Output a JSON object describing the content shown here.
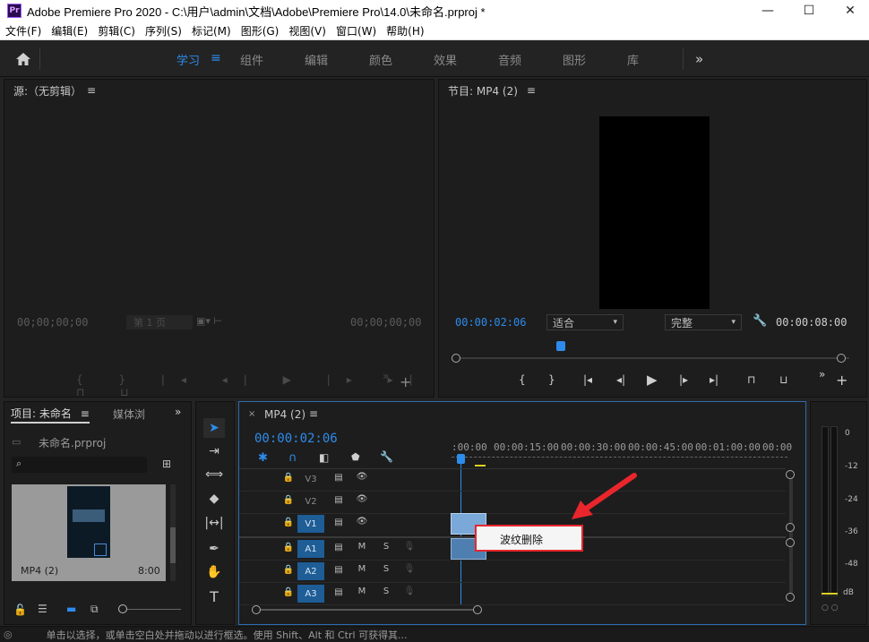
{
  "window": {
    "logo_text": "Pr",
    "title": "Adobe Premiere Pro 2020 - C:\\用户\\admin\\文档\\Adobe\\Premiere Pro\\14.0\\未命名.prproj *",
    "minimize": "—",
    "maximize": "☐",
    "close": "✕"
  },
  "menu": [
    "文件(F)",
    "编辑(E)",
    "剪辑(C)",
    "序列(S)",
    "标记(M)",
    "图形(G)",
    "视图(V)",
    "窗口(W)",
    "帮助(H)"
  ],
  "workspaces": {
    "home_icon": "home-icon",
    "items": [
      "学习",
      "组件",
      "编辑",
      "颜色",
      "效果",
      "音频",
      "图形",
      "库"
    ],
    "active": "学习",
    "more": "»"
  },
  "source_panel": {
    "title": "源:（无剪辑）",
    "timecode_left": "00;00;00;00",
    "page": "第 1 页",
    "timecode_right": "00;00;00;00"
  },
  "program_panel": {
    "title": "节目: MP4 (2)",
    "timecode": "00:00:02:06",
    "fit_option": "适合",
    "quality_option": "完整",
    "duration": "00:00:08:00"
  },
  "project_panel": {
    "tab_project": "项目: 未命名",
    "tab_media": "媒体浏",
    "file_name": "未命名.prproj",
    "search_placeholder": "",
    "clip_name": "MP4 (2)",
    "clip_duration": "8:00"
  },
  "timeline": {
    "sequence_tab": "MP4 (2)",
    "timecode": "00:00:02:06",
    "ruler": [
      ":00:00",
      "00:00:15:00",
      "00:00:30:00",
      "00:00:45:00",
      "00:01:00:00",
      "00:00"
    ],
    "video_tracks": [
      "V3",
      "V2",
      "V1"
    ],
    "audio_tracks": [
      "A1",
      "A2",
      "A3"
    ],
    "mute_label": "M",
    "solo_label": "S"
  },
  "context_menu": {
    "item": "波纹删除"
  },
  "audio_meter": {
    "scale": [
      "0",
      "-12",
      "-24",
      "-36",
      "-48",
      "dB"
    ]
  },
  "status": {
    "text": "单击以选择，或单击空白处并拖动以进行框选。使用 Shift、Alt 和 Ctrl 可获得其..."
  },
  "colors": {
    "accent": "#2d8ceb",
    "arrow": "#e8262c",
    "track_active": "#1e5d96"
  }
}
